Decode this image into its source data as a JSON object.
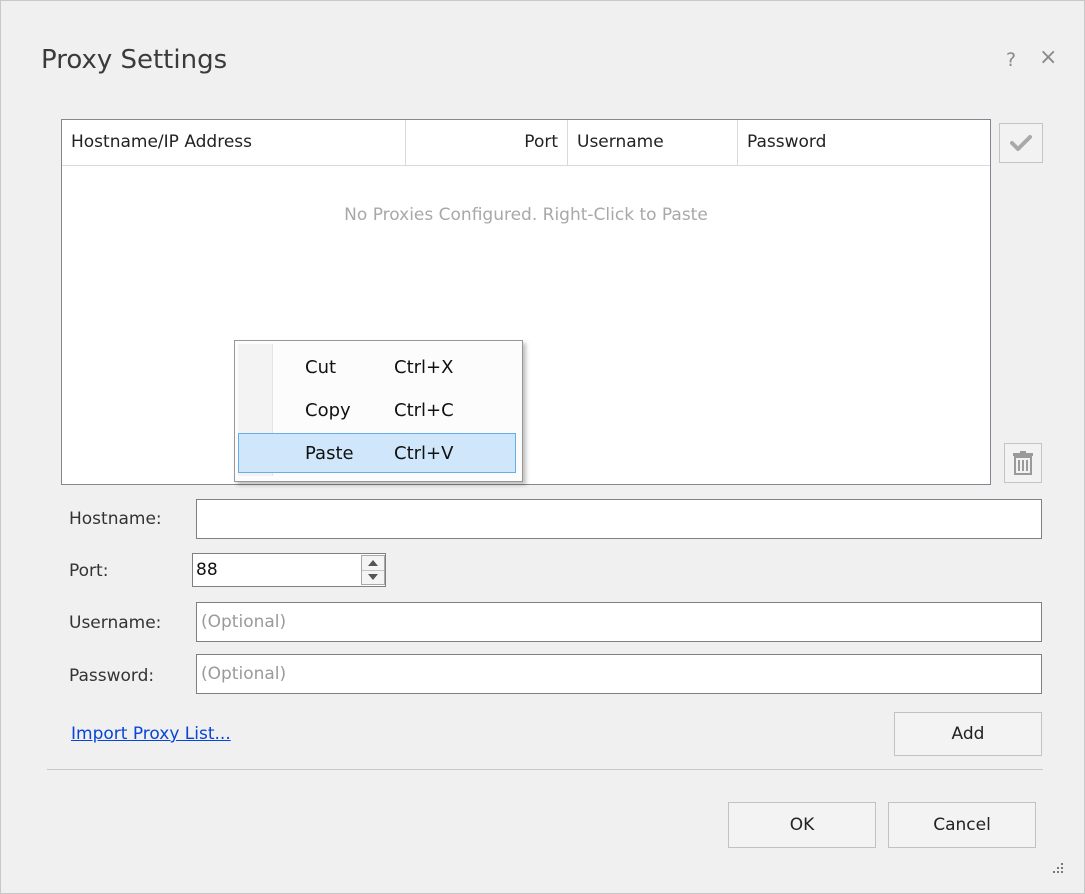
{
  "dialog": {
    "title": "Proxy Settings",
    "help_glyph": "?",
    "close_glyph": "×"
  },
  "grid": {
    "columns": [
      "Hostname/IP Address",
      "Port",
      "Username",
      "Password"
    ],
    "empty_message": "No Proxies Configured. Right-Click to Paste"
  },
  "side_buttons": {
    "confirm_icon": "checkmark-icon",
    "delete_icon": "trash-icon"
  },
  "context_menu": {
    "items": [
      {
        "label": "Cut",
        "shortcut": "Ctrl+X"
      },
      {
        "label": "Copy",
        "shortcut": "Ctrl+C"
      },
      {
        "label": "Paste",
        "shortcut": "Ctrl+V",
        "highlighted": true
      }
    ]
  },
  "form": {
    "hostname_label": "Hostname:",
    "hostname_value": "",
    "port_label": "Port:",
    "port_value": "88",
    "username_label": "Username:",
    "username_placeholder": "(Optional)",
    "password_label": "Password:",
    "password_placeholder": "(Optional)"
  },
  "actions": {
    "import_link": "Import Proxy List...",
    "add_label": "Add",
    "ok_label": "OK",
    "cancel_label": "Cancel"
  },
  "colors": {
    "highlight_fill": "#cfe6fb",
    "highlight_border": "#65aee8",
    "link": "#0645d8"
  }
}
